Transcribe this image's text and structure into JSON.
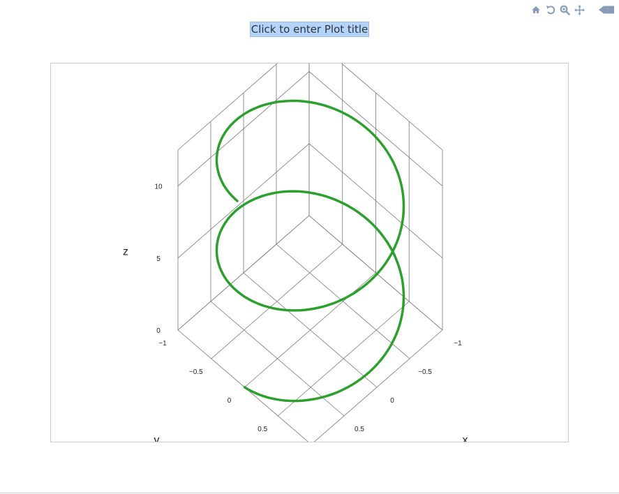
{
  "title": "Click to enter Plot title",
  "modebar": {
    "buttons": [
      {
        "name": "reset-camera-home",
        "icon": "home-icon"
      },
      {
        "name": "orbit-rotation",
        "icon": "rotate-icon"
      },
      {
        "name": "zoom",
        "icon": "magnifier-icon"
      },
      {
        "name": "pan",
        "icon": "pan-arrows-icon"
      },
      {
        "name": "collapse",
        "icon": "left-arrow-icon"
      }
    ],
    "color": "#8a9bb6"
  },
  "chart_data": {
    "type": "line3d",
    "title": "",
    "series": [
      {
        "color": "#2ca02c",
        "parametric": "helix: x = cos(t), y = sin(t), z = t",
        "t_range": [
          0,
          12.5
        ]
      }
    ],
    "axes": {
      "x": {
        "label": "x",
        "range": [
          -1,
          1
        ],
        "ticks": [
          "−1",
          "−0.5",
          "0",
          "0.5"
        ]
      },
      "y": {
        "label": "y",
        "range": [
          -1,
          1
        ],
        "ticks": [
          "−1",
          "−0.5",
          "0",
          "0.5"
        ]
      },
      "z": {
        "label": "z",
        "range": [
          0,
          12.5
        ],
        "ticks": [
          "0",
          "5",
          "10"
        ]
      }
    },
    "grid": true,
    "line_color": "#2ca02c",
    "grid_color": "#777777"
  }
}
